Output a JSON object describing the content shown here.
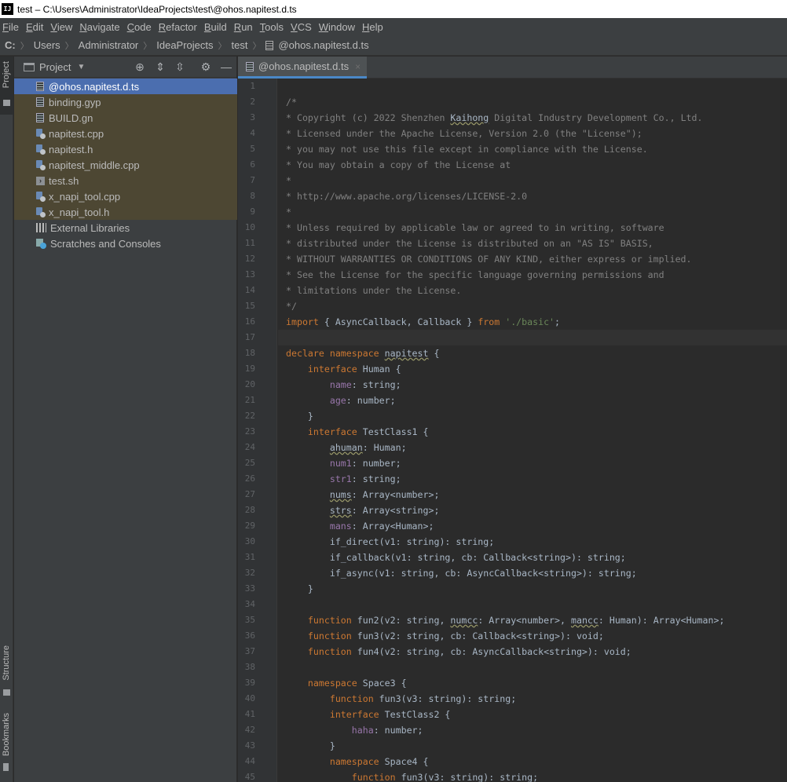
{
  "window": {
    "logo_text": "IJ",
    "title": "test – C:\\Users\\Administrator\\IdeaProjects\\test\\@ohos.napitest.d.ts"
  },
  "menu": [
    "File",
    "Edit",
    "View",
    "Navigate",
    "Code",
    "Refactor",
    "Build",
    "Run",
    "Tools",
    "VCS",
    "Window",
    "Help"
  ],
  "breadcrumb": [
    "C:",
    "Users",
    "Administrator",
    "IdeaProjects",
    "test",
    "@ohos.napitest.d.ts"
  ],
  "left_strip": {
    "project_label": "Project",
    "structure_label": "Structure",
    "bookmarks_label": "Bookmarks"
  },
  "project_panel": {
    "title": "Project",
    "tree": [
      {
        "label": "@ohos.napitest.d.ts",
        "icon": "ts-file-icon",
        "state": "selected"
      },
      {
        "label": "binding.gyp",
        "icon": "text-file-icon",
        "state": "scoped"
      },
      {
        "label": "BUILD.gn",
        "icon": "text-file-icon",
        "state": "scoped"
      },
      {
        "label": "napitest.cpp",
        "icon": "cpp-file-icon",
        "state": "scoped"
      },
      {
        "label": "napitest.h",
        "icon": "cpp-file-icon",
        "state": "scoped"
      },
      {
        "label": "napitest_middle.cpp",
        "icon": "cpp-file-icon",
        "state": "scoped"
      },
      {
        "label": "test.sh",
        "icon": "shell-file-icon",
        "state": "scoped"
      },
      {
        "label": "x_napi_tool.cpp",
        "icon": "cpp-file-icon",
        "state": "scoped"
      },
      {
        "label": "x_napi_tool.h",
        "icon": "cpp-file-icon",
        "state": "scoped"
      },
      {
        "label": "External Libraries",
        "icon": "library-icon",
        "state": "normal"
      },
      {
        "label": "Scratches and Consoles",
        "icon": "scratches-icon",
        "state": "normal"
      }
    ]
  },
  "editor": {
    "tab_label": "@ohos.napitest.d.ts",
    "tab_close": "×",
    "current_line": 17,
    "lines": [
      [],
      [
        [
          "c",
          "/*"
        ]
      ],
      [
        [
          "c",
          "* Copyright (c) 2022 Shenzhen "
        ],
        [
          "cw",
          "Kaihong"
        ],
        [
          "c",
          " Digital Industry Development Co., Ltd."
        ]
      ],
      [
        [
          "c",
          "* Licensed under the Apache License, Version 2.0 (the \"License\");"
        ]
      ],
      [
        [
          "c",
          "* you may not use this file except in compliance with the License."
        ]
      ],
      [
        [
          "c",
          "* You may obtain a copy of the License at"
        ]
      ],
      [
        [
          "c",
          "*"
        ]
      ],
      [
        [
          "c",
          "* http://www.apache.org/licenses/LICENSE-2.0"
        ]
      ],
      [
        [
          "c",
          "*"
        ]
      ],
      [
        [
          "c",
          "* Unless required by applicable law or agreed to in writing, software"
        ]
      ],
      [
        [
          "c",
          "* distributed under the License is distributed on an \"AS IS\" BASIS,"
        ]
      ],
      [
        [
          "c",
          "* WITHOUT WARRANTIES OR CONDITIONS OF ANY KIND, either express or implied."
        ]
      ],
      [
        [
          "c",
          "* See the License for the specific language governing permissions and"
        ]
      ],
      [
        [
          "c",
          "* limitations under the License."
        ]
      ],
      [
        [
          "c",
          "*/"
        ]
      ],
      [
        [
          "k",
          "import"
        ],
        [
          "t",
          " { AsyncCallback, Callback } "
        ],
        [
          "k",
          "from"
        ],
        [
          "t",
          " "
        ],
        [
          "s",
          "'./basic'"
        ],
        [
          "t",
          ";"
        ]
      ],
      [],
      [
        [
          "k",
          "declare namespace"
        ],
        [
          "t",
          " "
        ],
        [
          "w",
          "napitest"
        ],
        [
          "t",
          " {"
        ]
      ],
      [
        [
          "t",
          "    "
        ],
        [
          "k",
          "interface"
        ],
        [
          "t",
          " Human {"
        ]
      ],
      [
        [
          "t",
          "        "
        ],
        [
          "p",
          "name"
        ],
        [
          "t",
          ": string;"
        ]
      ],
      [
        [
          "t",
          "        "
        ],
        [
          "p",
          "age"
        ],
        [
          "t",
          ": number;"
        ]
      ],
      [
        [
          "t",
          "    }"
        ]
      ],
      [
        [
          "t",
          "    "
        ],
        [
          "k",
          "interface"
        ],
        [
          "t",
          " TestClass1 {"
        ]
      ],
      [
        [
          "t",
          "        "
        ],
        [
          "pw",
          "ahuman"
        ],
        [
          "t",
          ": Human;"
        ]
      ],
      [
        [
          "t",
          "        "
        ],
        [
          "p",
          "num1"
        ],
        [
          "t",
          ": number;"
        ]
      ],
      [
        [
          "t",
          "        "
        ],
        [
          "p",
          "str1"
        ],
        [
          "t",
          ": string;"
        ]
      ],
      [
        [
          "t",
          "        "
        ],
        [
          "pw",
          "nums"
        ],
        [
          "t",
          ": Array<number>;"
        ]
      ],
      [
        [
          "t",
          "        "
        ],
        [
          "pw",
          "strs"
        ],
        [
          "t",
          ": Array<string>;"
        ]
      ],
      [
        [
          "t",
          "        "
        ],
        [
          "p",
          "mans"
        ],
        [
          "t",
          ": Array<Human>;"
        ]
      ],
      [
        [
          "t",
          "        "
        ],
        [
          "t",
          "if_direct(v1: string): string;"
        ]
      ],
      [
        [
          "t",
          "        "
        ],
        [
          "t",
          "if_callback(v1: string, cb: Callback<string>): string;"
        ]
      ],
      [
        [
          "t",
          "        "
        ],
        [
          "t",
          "if_async(v1: string, cb: AsyncCallback<string>): string;"
        ]
      ],
      [
        [
          "t",
          "    }"
        ]
      ],
      [],
      [
        [
          "t",
          "    "
        ],
        [
          "k",
          "function"
        ],
        [
          "t",
          " fun2(v2: string, "
        ],
        [
          "w",
          "numcc"
        ],
        [
          "t",
          ": Array<number>, "
        ],
        [
          "w",
          "mancc"
        ],
        [
          "t",
          ": Human): Array<Human>;"
        ]
      ],
      [
        [
          "t",
          "    "
        ],
        [
          "k",
          "function"
        ],
        [
          "t",
          " fun3(v2: string, cb: Callback<string>): void;"
        ]
      ],
      [
        [
          "t",
          "    "
        ],
        [
          "k",
          "function"
        ],
        [
          "t",
          " fun4(v2: string, cb: AsyncCallback<string>): void;"
        ]
      ],
      [],
      [
        [
          "t",
          "    "
        ],
        [
          "k",
          "namespace"
        ],
        [
          "t",
          " Space3 {"
        ]
      ],
      [
        [
          "t",
          "        "
        ],
        [
          "k",
          "function"
        ],
        [
          "t",
          " fun3(v3: string): string;"
        ]
      ],
      [
        [
          "t",
          "        "
        ],
        [
          "k",
          "interface"
        ],
        [
          "t",
          " TestClass2 {"
        ]
      ],
      [
        [
          "t",
          "            "
        ],
        [
          "p",
          "haha"
        ],
        [
          "t",
          ": number;"
        ]
      ],
      [
        [
          "t",
          "        }"
        ]
      ],
      [
        [
          "t",
          "        "
        ],
        [
          "k",
          "namespace"
        ],
        [
          "t",
          " Space4 {"
        ]
      ],
      [
        [
          "t",
          "            "
        ],
        [
          "k",
          "function"
        ],
        [
          "t",
          " fun3(v3: string): string;"
        ]
      ]
    ]
  }
}
